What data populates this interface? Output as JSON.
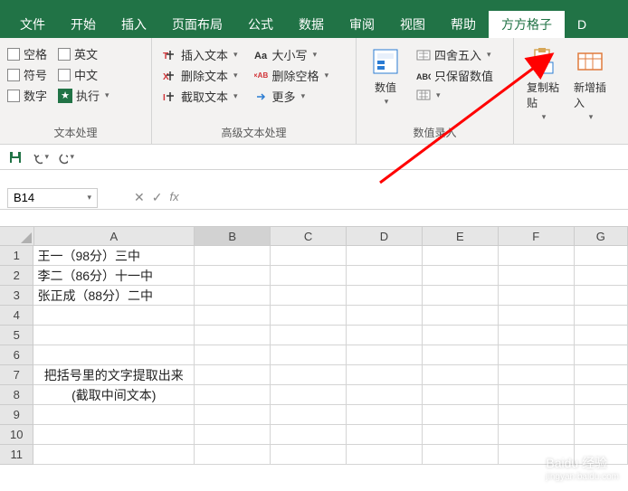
{
  "tabs": {
    "file": "文件",
    "home": "开始",
    "insert": "插入",
    "pagelayout": "页面布局",
    "formulas": "公式",
    "data": "数据",
    "review": "审阅",
    "view": "视图",
    "help": "帮助",
    "ffgz": "方方格子",
    "d": "D"
  },
  "ribbon": {
    "group1_label": "文本处理",
    "group2_label": "高级文本处理",
    "group3_label": "数值录入",
    "chk_space": "空格",
    "chk_en": "英文",
    "chk_symbol": "符号",
    "chk_cn": "中文",
    "chk_num": "数字",
    "chk_exec": "执行",
    "insert_text": "插入文本",
    "delete_text": "删除文本",
    "extract_text": "截取文本",
    "case": "大小写",
    "delete_space": "删除空格",
    "more": "更多",
    "numeric": "数值",
    "round": "四舍五入",
    "keep_num": "只保留数值",
    "copy_paste": "复制粘贴",
    "add_ins": "新增插入"
  },
  "namebox": "B14",
  "columns": [
    "A",
    "B",
    "C",
    "D",
    "E",
    "F",
    "G"
  ],
  "rows": [
    "1",
    "2",
    "3",
    "4",
    "5",
    "6",
    "7",
    "8",
    "9",
    "10",
    "11"
  ],
  "cells": {
    "A1": "王一（98分）三中",
    "A2": "李二（86分）十一中",
    "A3": "张正成（88分）二中",
    "A7": "把括号里的文字提取出来",
    "A8": "(截取中间文本)"
  },
  "watermark": {
    "main": "Baidu 经验",
    "sub": "jingyan.baidu.com"
  }
}
